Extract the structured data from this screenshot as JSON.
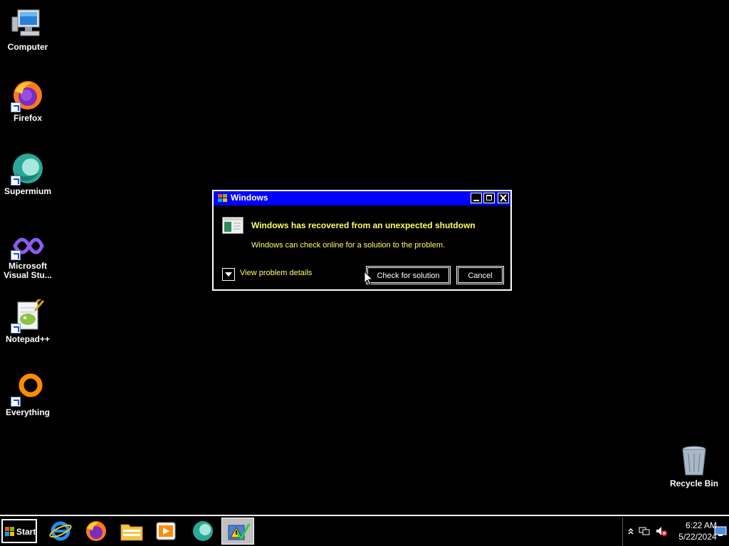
{
  "desktop": {
    "icons": [
      {
        "label": "Computer",
        "icon": "computer-icon"
      },
      {
        "label": "Firefox",
        "icon": "firefox-icon"
      },
      {
        "label": "Supermium",
        "icon": "supermium-icon"
      },
      {
        "label": "Microsoft Visual Stu...",
        "icon": "visual-studio-icon"
      },
      {
        "label": "Notepad++",
        "icon": "notepad-plus-plus-icon"
      },
      {
        "label": "Everything",
        "icon": "everything-icon"
      },
      {
        "label": "Recycle Bin",
        "icon": "recycle-bin-icon"
      }
    ]
  },
  "dialog": {
    "title": "Windows",
    "headline": "Windows has recovered from an unexpected shutdown",
    "subtext": "Windows can check online for a solution to the problem.",
    "details_label": "View problem details",
    "check_button": "Check for solution",
    "cancel_button": "Cancel"
  },
  "taskbar": {
    "start_label": "Start",
    "pinned": [
      "internet-explorer-icon",
      "firefox-icon",
      "file-explorer-icon",
      "media-player-icon",
      "supermium-icon",
      "problem-reports-icon"
    ],
    "tray": {
      "time": "6:22 AM",
      "date": "5/22/2024"
    }
  },
  "colors": {
    "background": "#000000",
    "titlebar": "#0000ff",
    "dialog_text": "#ffff66",
    "border": "#ffffff"
  }
}
